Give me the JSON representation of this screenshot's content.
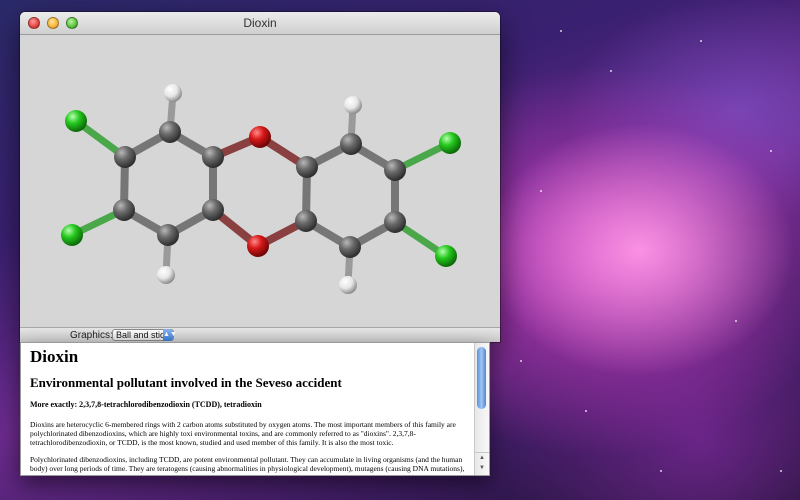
{
  "window": {
    "title": "Dioxin"
  },
  "molecule_view": {
    "render_mode": "Ball and stick",
    "atom_colors": {
      "carbon": "#5d5d5d",
      "oxygen": "#d11414",
      "chlorine": "#22c41c",
      "hydrogen": "#f2f2f2"
    }
  },
  "statusbar": {
    "graphics_label": "Graphics:",
    "graphics_value": "Ball and stick"
  },
  "info": {
    "heading": "Dioxin",
    "subheading": "Environmental pollutant involved in the Seveso accident",
    "exact": "More exactly: 2,3,7,8-tetrachlorodibenzodioxin (TCDD), tetradioxin",
    "paragraph1": "Dioxins are heterocyclic 6-membered rings with 2 carbon atoms substituted by oxygen atoms. The most important members of this family are polychlorinated dibenzodioxins, which are highly toxi environmental toxins, and are commonly referred to as \"dioxins\". 2,3,7,8-tetrachlorodibenzodioxin, or TCDD, is the most known, studied and used member of this family. It is also the most toxic.",
    "paragraph2": "Polychlorinated dibenzodioxins, including TCDD, are potent environmental pollutant. They can accumulate in living organisms (and the human body) over long periods of time. They are teratogens (causing abnormalities in physiological development), mutagens (causing DNA mutations), and"
  }
}
